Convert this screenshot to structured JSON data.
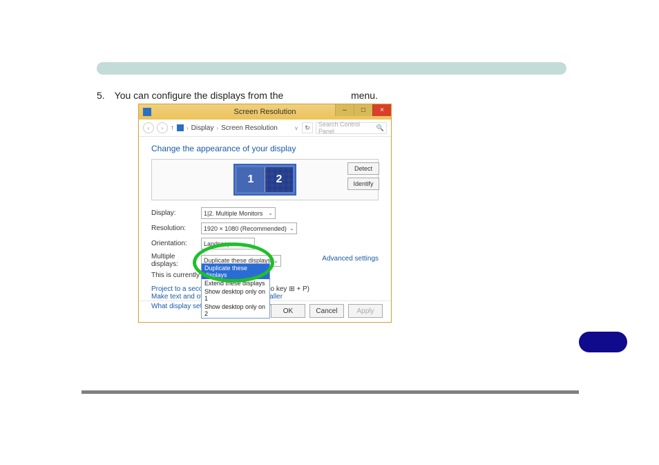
{
  "step": {
    "number": "5.",
    "text_before": "You can configure the displays from the ",
    "text_after": "menu."
  },
  "window": {
    "title": "Screen Resolution",
    "controls": {
      "minimize": "–",
      "maximize": "□",
      "close": "×"
    },
    "breadcrumb": {
      "level1": "Display",
      "level2": "Screen Resolution",
      "sep": "›"
    },
    "search_placeholder": "Search Control Panel",
    "heading": "Change the appearance of your display",
    "buttons": {
      "detect": "Detect",
      "identify": "Identify"
    },
    "monitors": {
      "a": "1",
      "b": "2"
    },
    "labels": {
      "display": "Display:",
      "resolution": "Resolution:",
      "orientation": "Orientation:",
      "multiple": "Multiple displays:"
    },
    "values": {
      "display": "1|2. Multiple Monitors",
      "resolution": "1920 × 1080 (Recommended)",
      "orientation": "Landscape",
      "multiple": "Duplicate these displays"
    },
    "multi_options": [
      "Duplicate these displays",
      "Extend these displays",
      "Show desktop only on 1",
      "Show desktop only on 2"
    ],
    "status_prefix": "This is currently you",
    "advanced": "Advanced settings",
    "project_link_prefix": "Project to a second ",
    "project_link_suffix": " logo key ",
    "project_key_combo": " + P)",
    "link2": "Make text and other items larger or smaller",
    "link3": "What display settings should I choose?",
    "footer": {
      "ok": "OK",
      "cancel": "Cancel",
      "apply": "Apply"
    }
  }
}
